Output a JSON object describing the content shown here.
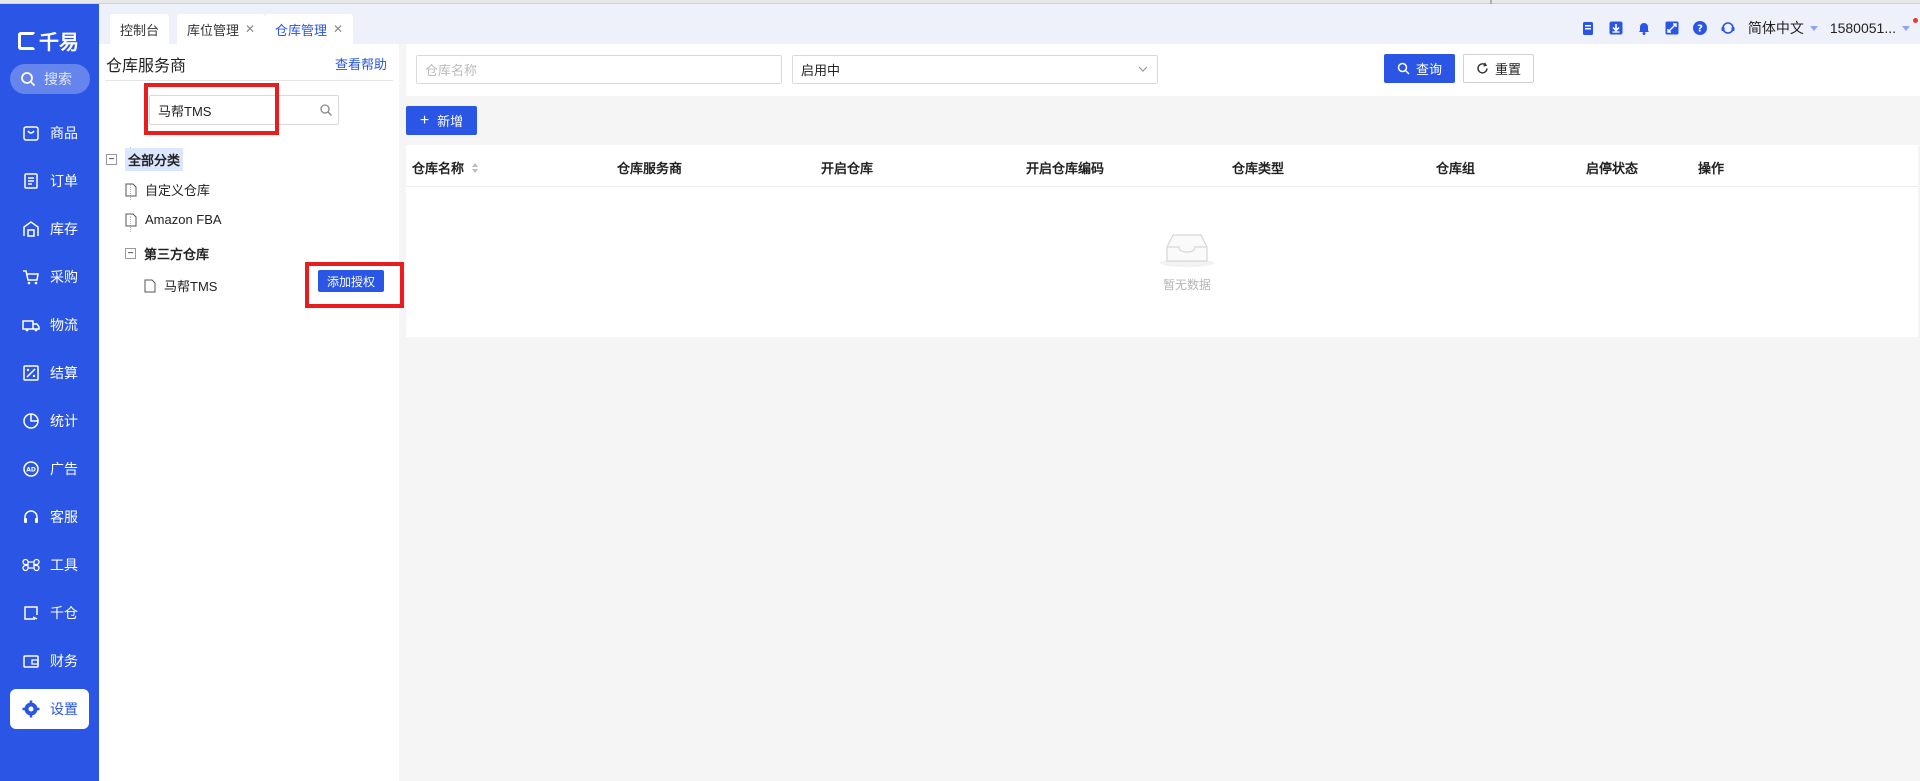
{
  "app": {
    "logo_text": "千易"
  },
  "sidebar": {
    "search_label": "搜索",
    "items": [
      {
        "label": "商品",
        "icon": "bag-icon"
      },
      {
        "label": "订单",
        "icon": "document-icon"
      },
      {
        "label": "库存",
        "icon": "warehouse-icon"
      },
      {
        "label": "采购",
        "icon": "cart-icon"
      },
      {
        "label": "物流",
        "icon": "truck-icon"
      },
      {
        "label": "结算",
        "icon": "percent-icon"
      },
      {
        "label": "统计",
        "icon": "pie-chart-icon"
      },
      {
        "label": "广告",
        "icon": "ad-icon"
      },
      {
        "label": "客服",
        "icon": "headset-icon"
      },
      {
        "label": "工具",
        "icon": "command-icon"
      },
      {
        "label": "千仓",
        "icon": "qiancang-icon"
      },
      {
        "label": "财务",
        "icon": "wallet-icon"
      },
      {
        "label": "设置",
        "icon": "gear-icon",
        "active": true
      }
    ]
  },
  "tabs": [
    {
      "label": "控制台",
      "closable": false
    },
    {
      "label": "库位管理",
      "closable": true
    },
    {
      "label": "仓库管理",
      "closable": true,
      "active": true
    }
  ],
  "header": {
    "language": "简体中文",
    "user": "1580051..."
  },
  "left_panel": {
    "title": "仓库服务商",
    "help_link": "查看帮助",
    "search_value": "马帮TMS",
    "tree": {
      "root": "全部分类",
      "children": [
        "自定义仓库",
        "Amazon FBA"
      ],
      "group": "第三方仓库",
      "group_children": [
        "马帮TMS"
      ]
    },
    "add_auth_button": "添加授权"
  },
  "filters": {
    "name_placeholder": "仓库名称",
    "status_value": "启用中",
    "query_button": "查询",
    "reset_button": "重置"
  },
  "add_button": "新增",
  "table": {
    "columns": [
      "仓库名称",
      "仓库服务商",
      "开启仓库",
      "开启仓库编码",
      "仓库类型",
      "仓库组",
      "启停状态",
      "操作"
    ],
    "rows": [],
    "empty_text": "暂无数据"
  },
  "colors": {
    "brand": "#2a55e5",
    "highlight_box": "#e81e1e"
  }
}
